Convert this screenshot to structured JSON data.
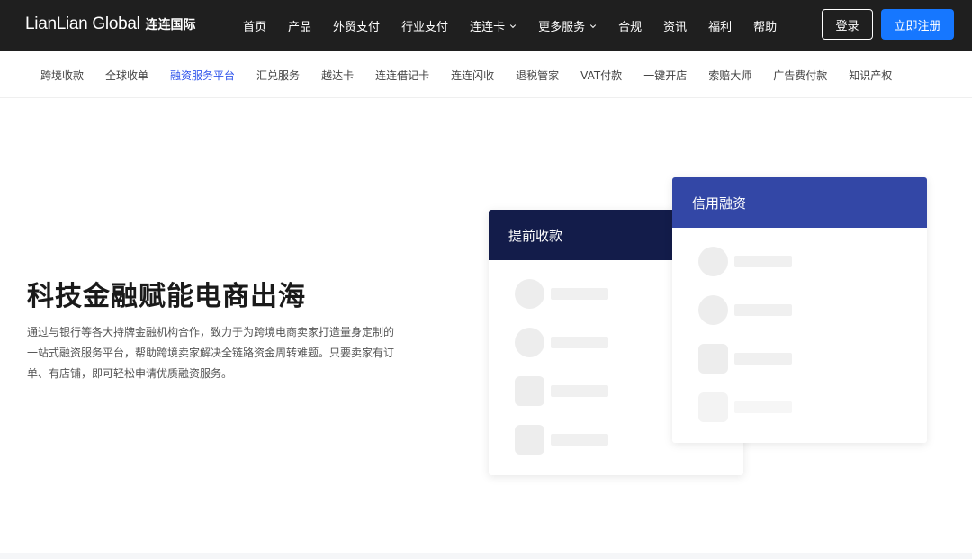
{
  "header": {
    "logo_en": "LianLian Global",
    "logo_cn": "连连国际",
    "nav": [
      {
        "label": "首页"
      },
      {
        "label": "产品"
      },
      {
        "label": "外贸支付"
      },
      {
        "label": "行业支付"
      },
      {
        "label": "连连卡",
        "dropdown": true
      },
      {
        "label": "更多服务",
        "dropdown": true
      },
      {
        "label": "合规"
      },
      {
        "label": "资讯"
      },
      {
        "label": "福利"
      },
      {
        "label": "帮助"
      }
    ],
    "login_label": "登录",
    "register_label": "立即注册"
  },
  "subnav": {
    "items": [
      {
        "label": "跨境收款"
      },
      {
        "label": "全球收单"
      },
      {
        "label": "融资服务平台",
        "active": true
      },
      {
        "label": "汇兑服务"
      },
      {
        "label": "越达卡"
      },
      {
        "label": "连连借记卡"
      },
      {
        "label": "连连闪收"
      },
      {
        "label": "退税管家"
      },
      {
        "label": "VAT付款"
      },
      {
        "label": "一键开店"
      },
      {
        "label": "索赔大师"
      },
      {
        "label": "广告费付款"
      },
      {
        "label": "知识产权"
      }
    ]
  },
  "hero": {
    "title": "科技金融赋能电商出海",
    "description": "通过与银行等各大持牌金融机构合作，致力于为跨境电商卖家打造量身定制的一站式融资服务平台，帮助跨境卖家解决全链路资金周转难题。只要卖家有订单、有店铺，即可轻松申请优质融资服务。"
  },
  "cards": {
    "advance": {
      "title": "提前收款",
      "header_color": "#131c4a"
    },
    "credit": {
      "title": "信用融资",
      "header_color": "#3347a6"
    }
  },
  "colors": {
    "topbar": "#1f1f1f",
    "accent": "#1677ff",
    "subnav_active": "#2f54eb"
  }
}
